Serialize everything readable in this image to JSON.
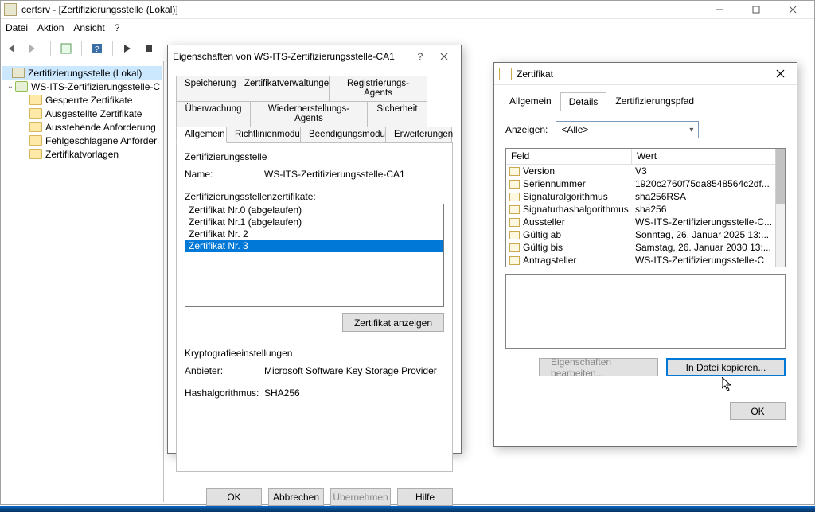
{
  "window": {
    "title": "certsrv - [Zertifizierungsstelle (Lokal)]",
    "menu": {
      "file": "Datei",
      "action": "Aktion",
      "view": "Ansicht",
      "help": "?"
    }
  },
  "tree": {
    "root": "Zertifizierungsstelle (Lokal)",
    "ca": "WS-ITS-Zertifizierungsstelle-C",
    "children": {
      "revoked": "Gesperrte Zertifikate",
      "issued": "Ausgestellte Zertifikate",
      "pending": "Ausstehende Anforderung",
      "failed": "Fehlgeschlagene Anforder",
      "templates": "Zertifikatvorlagen"
    }
  },
  "props": {
    "title": "Eigenschaften von WS-ITS-Zertifizierungsstelle-CA1",
    "tabs": {
      "storage": "Speicherung",
      "certmgr": "Zertifikatverwaltungen",
      "agents": "Registrierungs-Agents",
      "audit": "Überwachung",
      "recovery": "Wiederherstellungs-Agents",
      "security": "Sicherheit",
      "general": "Allgemein",
      "policy": "Richtlinienmodul",
      "exit": "Beendigungsmodul",
      "ext": "Erweiterungen"
    },
    "ca_label": "Zertifizierungsstelle",
    "name_label": "Name:",
    "name_value": "WS-ITS-Zertifizierungsstelle-CA1",
    "certs_label": "Zertifizierungsstellenzertifikate:",
    "cert_items": {
      "c0": "Zertifikat Nr.0 (abgelaufen)",
      "c1": "Zertifikat Nr.1 (abgelaufen)",
      "c2": "Zertifikat Nr. 2",
      "c3": "Zertifikat Nr. 3"
    },
    "view_cert": "Zertifikat anzeigen",
    "crypto_label": "Kryptografieeinstellungen",
    "provider_label": "Anbieter:",
    "provider_value": "Microsoft Software Key Storage Provider",
    "hash_label": "Hashalgorithmus:",
    "hash_value": "SHA256",
    "ok": "OK",
    "cancel": "Abbrechen",
    "apply": "Übernehmen",
    "help": "Hilfe"
  },
  "cert": {
    "title": "Zertifikat",
    "tabs": {
      "general": "Allgemein",
      "details": "Details",
      "path": "Zertifizierungspfad"
    },
    "show_label": "Anzeigen:",
    "show_value": "<Alle>",
    "col_field": "Feld",
    "col_value": "Wert",
    "rows": {
      "version": {
        "f": "Version",
        "v": "V3"
      },
      "serial": {
        "f": "Seriennummer",
        "v": "1920c2760f75da8548564c2df..."
      },
      "sigalg": {
        "f": "Signaturalgorithmus",
        "v": "sha256RSA"
      },
      "sighash": {
        "f": "Signaturhashalgorithmus",
        "v": "sha256"
      },
      "issuer": {
        "f": "Aussteller",
        "v": "WS-ITS-Zertifizierungsstelle-C..."
      },
      "validfrom": {
        "f": "Gültig ab",
        "v": "Sonntag, 26. Januar 2025 13:..."
      },
      "validto": {
        "f": "Gültig bis",
        "v": "Samstag, 26. Januar 2030 13:..."
      },
      "subject": {
        "f": "Antragsteller",
        "v": "WS-ITS-Zertifizierungsstelle-C"
      }
    },
    "edit_props": "Eigenschaften bearbeiten...",
    "copy_file": "In Datei kopieren...",
    "ok": "OK"
  }
}
